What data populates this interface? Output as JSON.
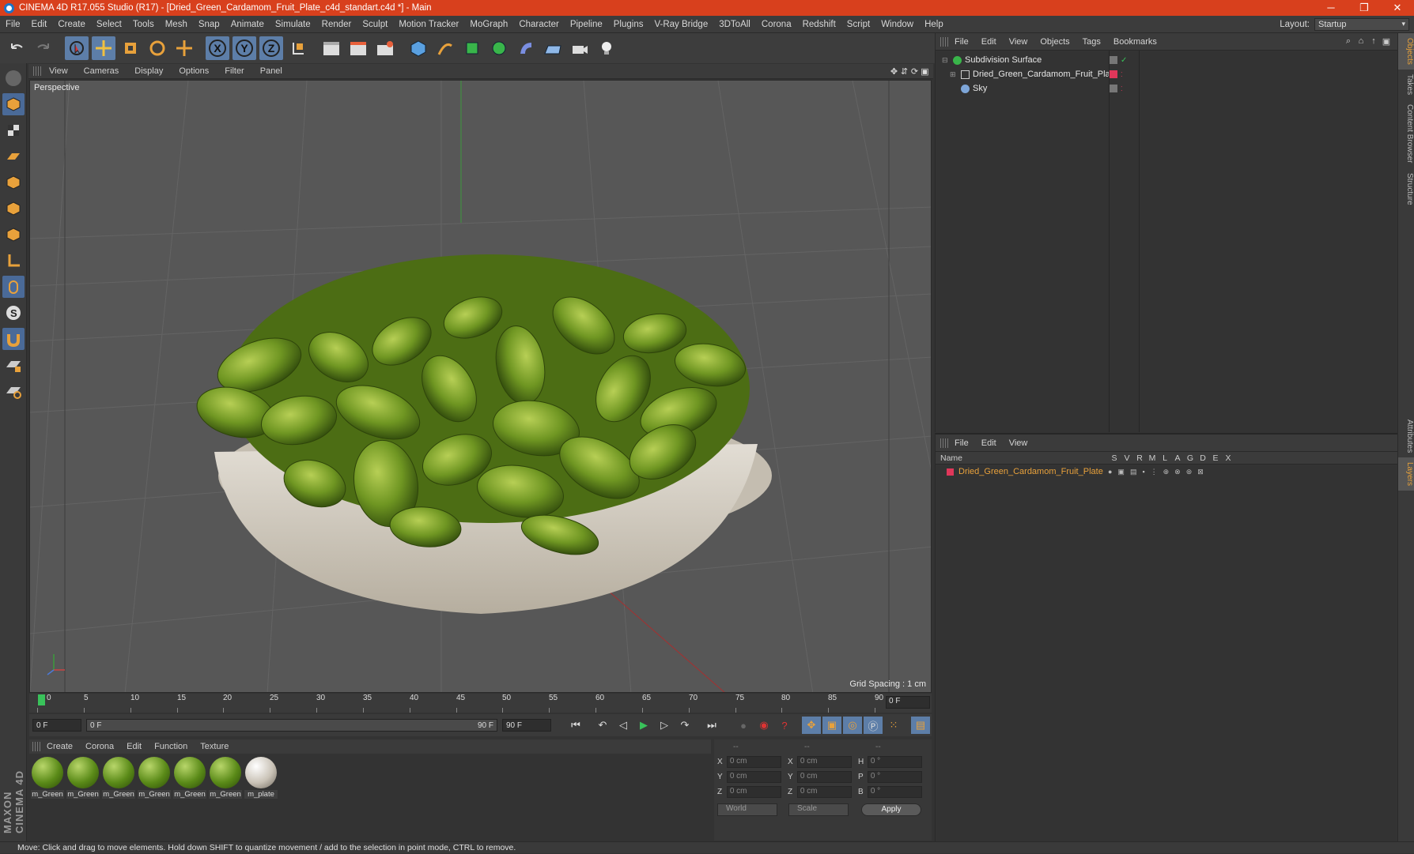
{
  "titlebar": {
    "title": "CINEMA 4D R17.055 Studio (R17) - [Dried_Green_Cardamom_Fruit_Plate_c4d_standart.c4d *] - Main",
    "minimize": "─",
    "restore": "❐",
    "close": "✕"
  },
  "menubar": {
    "items": [
      "File",
      "Edit",
      "Create",
      "Select",
      "Tools",
      "Mesh",
      "Snap",
      "Animate",
      "Simulate",
      "Render",
      "Sculpt",
      "Motion Tracker",
      "MoGraph",
      "Character",
      "Pipeline",
      "Plugins",
      "V-Ray Bridge",
      "3DToAll",
      "Corona",
      "Redshift",
      "Script",
      "Window",
      "Help"
    ],
    "layout_label": "Layout:",
    "layout_value": "Startup"
  },
  "toolbar": {
    "axis_x": "X",
    "axis_y": "Y",
    "axis_z": "Z"
  },
  "viewport": {
    "menu": [
      "View",
      "Cameras",
      "Display",
      "Options",
      "Filter",
      "Panel"
    ],
    "label": "Perspective",
    "grid_spacing": "Grid Spacing : 1 cm"
  },
  "timeline": {
    "ticks": [
      "0",
      "5",
      "10",
      "15",
      "20",
      "25",
      "30",
      "35",
      "40",
      "45",
      "50",
      "55",
      "60",
      "65",
      "70",
      "75",
      "80",
      "85",
      "90"
    ],
    "end_frame": "0 F"
  },
  "transport": {
    "start": "0 F",
    "range_start": "0 F",
    "range_end": "90 F",
    "end": "90 F"
  },
  "materials": {
    "menu": [
      "Create",
      "Corona",
      "Edit",
      "Function",
      "Texture"
    ],
    "items": [
      {
        "name": "m_Green"
      },
      {
        "name": "m_Green"
      },
      {
        "name": "m_Green"
      },
      {
        "name": "m_Green"
      },
      {
        "name": "m_Green"
      },
      {
        "name": "m_Green"
      },
      {
        "name": "m_plate"
      }
    ]
  },
  "coords": {
    "header": [
      "--",
      "--",
      "--"
    ],
    "rows": [
      {
        "a": "X",
        "v1": "0 cm",
        "b": "X",
        "v2": "0 cm",
        "c": "H",
        "v3": "0 °"
      },
      {
        "a": "Y",
        "v1": "0 cm",
        "b": "Y",
        "v2": "0 cm",
        "c": "P",
        "v3": "0 °"
      },
      {
        "a": "Z",
        "v1": "0 cm",
        "b": "Z",
        "v2": "0 cm",
        "c": "B",
        "v3": "0 °"
      }
    ],
    "world": "World",
    "scale": "Scale",
    "apply": "Apply"
  },
  "objects": {
    "menu": [
      "File",
      "Edit",
      "View",
      "Objects",
      "Tags",
      "Bookmarks"
    ],
    "items": [
      {
        "name": "Subdivision Surface",
        "icon_color": "#39b54a"
      },
      {
        "name": "Dried_Green_Cardamom_Fruit_Plate",
        "icon_color": "#cccccc"
      },
      {
        "name": "Sky",
        "icon_color": "#7ea6d8"
      }
    ]
  },
  "layers": {
    "menu": [
      "File",
      "Edit",
      "View"
    ],
    "columns": [
      "Name",
      "S",
      "V",
      "R",
      "M",
      "L",
      "A",
      "G",
      "D",
      "E",
      "X"
    ],
    "items": [
      {
        "name": "Dried_Green_Cardamom_Fruit_Plate",
        "color": "#e0375a"
      }
    ]
  },
  "right_tabs": [
    "Objects",
    "Takes",
    "Content Browser",
    "Structure",
    "Attributes",
    "Layers"
  ],
  "statusbar": {
    "text": "Move: Click and drag to move elements. Hold down SHIFT to quantize movement / add to the selection in point mode, CTRL to remove."
  },
  "maxon": {
    "text": "MAXON CINEMA 4D"
  },
  "colors": {
    "title_bg": "#d8401d",
    "accent": "#5d7ea8",
    "layer_name": "#e8a13b"
  }
}
